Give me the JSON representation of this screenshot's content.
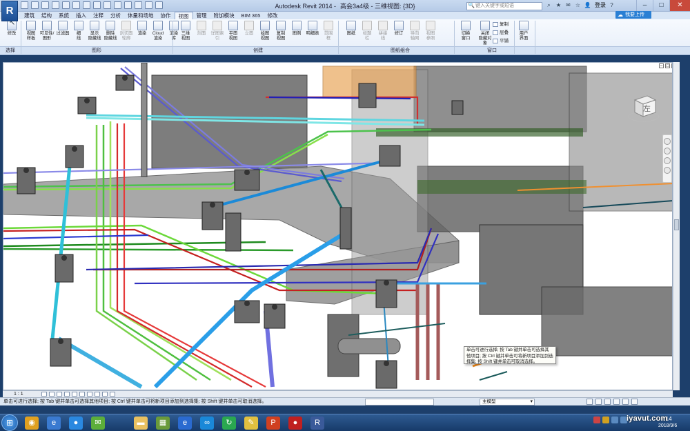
{
  "window": {
    "title": "Autodesk Revit 2014 -",
    "project": "高会3a4级 - 三维视图: {3D}",
    "search_placeholder": "键入关键字或短语",
    "login": "登录",
    "upload_button": "我要上传"
  },
  "app_logo": "R",
  "tabs": [
    "建筑",
    "结构",
    "系统",
    "插入",
    "注释",
    "分析",
    "体量和场地",
    "协作",
    "视图",
    "管理",
    "附加模块",
    "BIM 365",
    "修改"
  ],
  "active_tab": "视图",
  "ribbon": {
    "modify": "修改",
    "select_label": "选择",
    "panels": [
      "图形",
      "创建",
      "图纸组合",
      "窗口"
    ],
    "graphics_buttons": [
      "视图\n样板",
      "可见性/\n图形",
      "过滤器",
      "细\n线",
      "显示\n隐藏线",
      "删除\n隐藏线",
      "剖切面\n轮廓",
      "渲染",
      "Cloud\n渲染",
      "渲染\n库"
    ],
    "create_buttons": [
      "三维\n视图",
      "剖面",
      "详图索引",
      "平面\n视图",
      "立面",
      "绘图\n视图",
      "复制\n视图",
      "图例",
      "明细表",
      "范围\n框"
    ],
    "sheet_buttons": [
      "图纸",
      "标题\n栏",
      "拼接\n线",
      "修订",
      "导向\n轴网",
      "视图\n参照"
    ],
    "window_buttons": [
      "切换\n窗口",
      "关闭\n隐藏对象",
      "用户\n界面"
    ],
    "window_small": [
      "复制",
      "层叠",
      "平铺"
    ]
  },
  "viewport": {
    "viewcube_face": "左",
    "tooltip": "单击可进行选择; 按 Tab 键并单击可选择其他项目; 按 Ctrl 键并单击可将新项目添加到选择集; 按 Shift 键并单击可取消选择。"
  },
  "view_control": {
    "scale": "1 : 1"
  },
  "status": {
    "text": "单击可进行选择; 按 Tab 键并单击可选择其他项目; 按 Ctrl 键并单击可将新项目添加到选择集; 按 Shift 键并单击可取消选择。",
    "model_dropdown": "主模型",
    "selection_count": ":0"
  },
  "taskbar": {
    "time": "7:14",
    "date": "2018/9/6"
  },
  "watermark": "iyavut.com"
}
